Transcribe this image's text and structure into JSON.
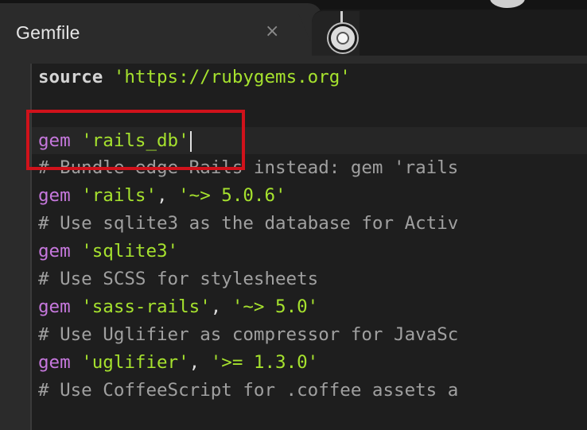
{
  "tab": {
    "title": "Gemfile",
    "close_label": "×"
  },
  "code_lines": [
    {
      "parts": [
        {
          "t": "source ",
          "c": "kw"
        },
        {
          "t": "'https://rubygems.org'",
          "c": "str"
        }
      ]
    },
    {
      "parts": []
    },
    {
      "parts": [
        {
          "t": "gem ",
          "c": "gem"
        },
        {
          "t": "'rails_db'",
          "c": "str"
        }
      ],
      "current": true
    },
    {
      "parts": [
        {
          "t": "# Bundle edge Rails instead: gem 'rails",
          "c": "comment"
        }
      ]
    },
    {
      "parts": [
        {
          "t": "gem ",
          "c": "gem"
        },
        {
          "t": "'rails'",
          "c": "str"
        },
        {
          "t": ", ",
          "c": "plain"
        },
        {
          "t": "'~> 5.0.6'",
          "c": "str"
        }
      ]
    },
    {
      "parts": [
        {
          "t": "# Use sqlite3 as the database for Activ",
          "c": "comment"
        }
      ]
    },
    {
      "parts": [
        {
          "t": "gem ",
          "c": "gem"
        },
        {
          "t": "'sqlite3'",
          "c": "str"
        }
      ]
    },
    {
      "parts": [
        {
          "t": "# Use SCSS for stylesheets",
          "c": "comment"
        }
      ]
    },
    {
      "parts": [
        {
          "t": "gem ",
          "c": "gem"
        },
        {
          "t": "'sass-rails'",
          "c": "str"
        },
        {
          "t": ", ",
          "c": "plain"
        },
        {
          "t": "'~> 5.0'",
          "c": "str"
        }
      ]
    },
    {
      "parts": [
        {
          "t": "# Use Uglifier as compressor for JavaSc",
          "c": "comment"
        }
      ]
    },
    {
      "parts": [
        {
          "t": "gem ",
          "c": "gem"
        },
        {
          "t": "'uglifier'",
          "c": "str"
        },
        {
          "t": ", ",
          "c": "plain"
        },
        {
          "t": "'>= 1.3.0'",
          "c": "str"
        }
      ]
    },
    {
      "parts": [
        {
          "t": "# Use CoffeeScript for .coffee assets a",
          "c": "comment"
        }
      ]
    }
  ],
  "colors": {
    "background": "#1e1e1e",
    "keyword_gem": "#c678dd",
    "string": "#a6e22e",
    "comment": "#a0a0a0",
    "highlight_box": "#d0121b"
  }
}
